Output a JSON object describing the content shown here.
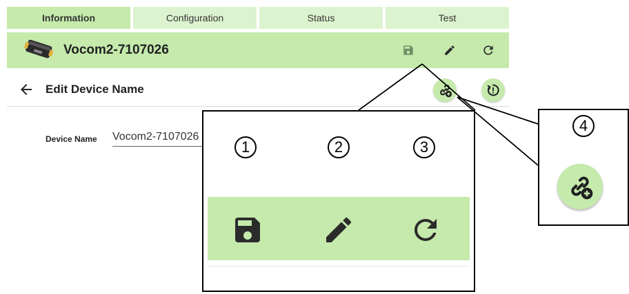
{
  "tabs": [
    {
      "label": "Information",
      "active": true
    },
    {
      "label": "Configuration",
      "active": false
    },
    {
      "label": "Status",
      "active": false
    },
    {
      "label": "Test",
      "active": false
    }
  ],
  "header": {
    "device_title": "Vocom2-7107026",
    "icons": [
      "save-icon",
      "edit-pencil-icon",
      "refresh-icon"
    ]
  },
  "subheader": {
    "title": "Edit Device Name",
    "icons": [
      "back-arrow-icon",
      "link-add-icon",
      "restart-icon"
    ]
  },
  "form": {
    "device_name_label": "Device Name",
    "device_name_value": "Vocom2-7107026"
  },
  "callouts": {
    "numbers": [
      "1",
      "2",
      "3",
      "4"
    ]
  },
  "colors": {
    "accent_green": "#c5eaac",
    "tab_inactive": "#dcf3cf",
    "icon_dark": "#2b2b2b",
    "disabled_icon": "#6f8f66"
  }
}
